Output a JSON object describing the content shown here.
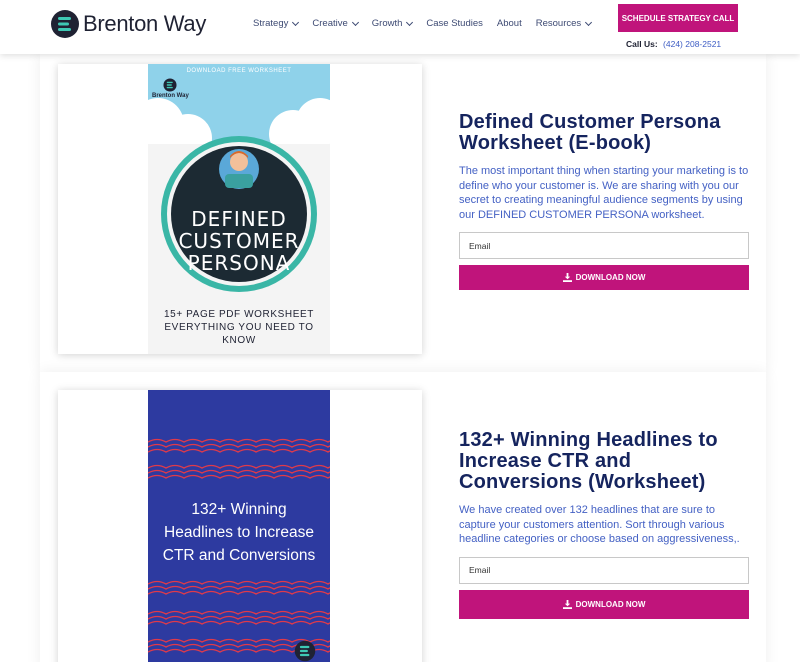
{
  "header": {
    "brand": "Brenton Way",
    "nav": [
      {
        "label": "Strategy",
        "dropdown": true
      },
      {
        "label": "Creative",
        "dropdown": true
      },
      {
        "label": "Growth",
        "dropdown": true
      },
      {
        "label": "Case Studies",
        "dropdown": false
      },
      {
        "label": "About",
        "dropdown": false
      },
      {
        "label": "Resources",
        "dropdown": true
      }
    ],
    "cta_label": "SCHEDULE STRATEGY CALL",
    "call_label": "Call Us:",
    "call_number": "(424) 208-2521"
  },
  "offers": [
    {
      "cover": {
        "top_label": "DOWNLOAD FREE WORKSHEET",
        "brand": "Brenton Way",
        "circle_lines": [
          "DEFINED",
          "CUSTOMER",
          "PERSONA"
        ],
        "bottom_lines": [
          "15+ PAGE PDF WORKSHEET",
          "EVERYTHING YOU NEED TO",
          "KNOW"
        ]
      },
      "title": "Defined Customer Persona Worksheet (E-book)",
      "description": "The most important thing when starting your marketing is to define who your customer is. We are sharing with you our secret to creating meaningful audience segments by using our DEFINED CUSTOMER PERSONA worksheet.",
      "email_placeholder": "Email",
      "button_label": "DOWNLOAD NOW"
    },
    {
      "cover": {
        "title_lines": [
          "132+ Winning",
          "Headlines to Increase",
          "CTR and Conversions"
        ]
      },
      "title": "132+ Winning Headlines to Increase CTR and Conversions (Worksheet)",
      "description": "We have created over 132 headlines that are sure to capture your customers attention. Sort through various headline categories or choose based on aggressiveness,.",
      "email_placeholder": "Email",
      "button_label": "DOWNLOAD NOW"
    }
  ],
  "colors": {
    "accent": "#c0147b",
    "title": "#15245e",
    "body": "#4461c4",
    "cover2_bg": "#2d3aa0",
    "wave": "#e03a4a"
  },
  "icons": [
    "brenton-way-logo-icon",
    "chevron-down-icon",
    "download-icon"
  ]
}
